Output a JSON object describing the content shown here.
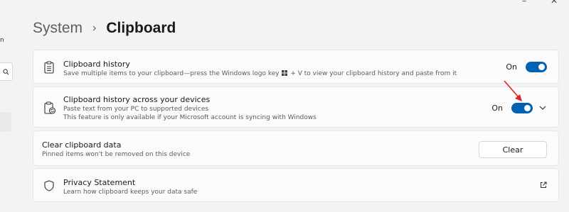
{
  "window": {
    "controls": [
      "–",
      "✕"
    ]
  },
  "sidebar": {
    "fragment_text": "n",
    "search_icon": "search-icon"
  },
  "breadcrumb": {
    "parent": "System",
    "separator": "›",
    "current": "Clipboard"
  },
  "cards": {
    "history": {
      "title": "Clipboard history",
      "description_before": "Save multiple items to your clipboard—press the Windows logo key",
      "description_after": "+ V to view your clipboard history and paste from it",
      "toggle_label": "On",
      "toggle_on": true
    },
    "sync": {
      "title": "Clipboard history across your devices",
      "description_line1": "Paste text from your PC to supported devices",
      "description_line2": "This feature is only available if your Microsoft account is syncing with Windows",
      "toggle_label": "On",
      "toggle_on": true
    },
    "clear": {
      "title": "Clear clipboard data",
      "description": "Pinned items won't be removed on this device",
      "button_label": "Clear"
    },
    "privacy": {
      "title": "Privacy Statement",
      "description": "Learn how clipboard keeps your data safe"
    }
  },
  "colors": {
    "accent": "#0062b1",
    "annotation_arrow": "#d9262a",
    "background": "#f3f3f3",
    "card": "#fbfbfb"
  }
}
